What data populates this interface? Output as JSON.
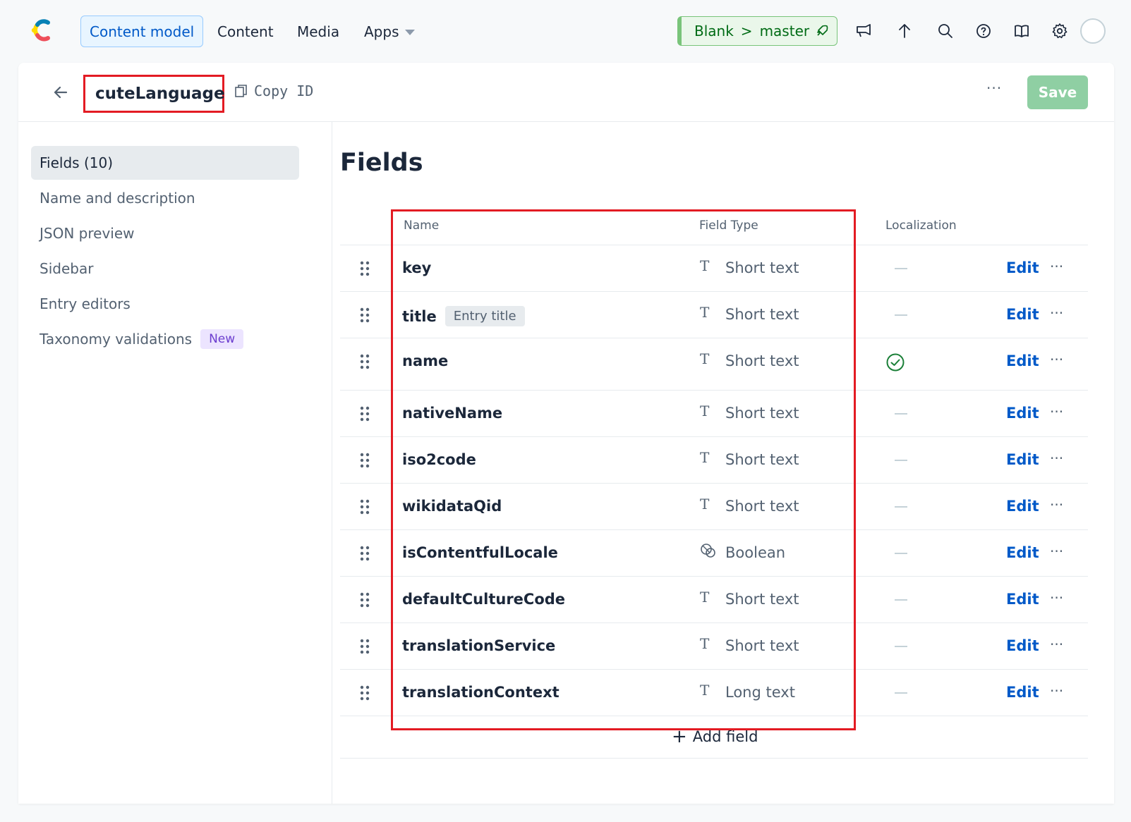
{
  "topnav": {
    "content_model": "Content model",
    "content": "Content",
    "media": "Media",
    "apps": "Apps",
    "env_space": "Blank",
    "env_sep": ">",
    "env_branch": "master"
  },
  "header": {
    "content_type_name": "cuteLanguage",
    "copy_id": "Copy ID",
    "more": "···",
    "save": "Save"
  },
  "sidebar": {
    "items": [
      {
        "label": "Fields (10)"
      },
      {
        "label": "Name and description"
      },
      {
        "label": "JSON preview"
      },
      {
        "label": "Sidebar"
      },
      {
        "label": "Entry editors"
      },
      {
        "label": "Taxonomy validations",
        "badge": "New"
      }
    ]
  },
  "fields": {
    "title": "Fields",
    "columns": {
      "name": "Name",
      "type": "Field Type",
      "localization": "Localization"
    },
    "rows": [
      {
        "name": "key",
        "type": "Short text",
        "icon": "T",
        "localized": false
      },
      {
        "name": "title",
        "badge": "Entry title",
        "type": "Short text",
        "icon": "T",
        "localized": false
      },
      {
        "name": "name",
        "type": "Short text",
        "icon": "T",
        "localized": true
      },
      {
        "name": "nativeName",
        "type": "Short text",
        "icon": "T",
        "localized": false
      },
      {
        "name": "iso2code",
        "type": "Short text",
        "icon": "T",
        "localized": false
      },
      {
        "name": "wikidataQid",
        "type": "Short text",
        "icon": "T",
        "localized": false
      },
      {
        "name": "isContentfulLocale",
        "type": "Boolean",
        "icon": "toggle-icon",
        "localized": false
      },
      {
        "name": "defaultCultureCode",
        "type": "Short text",
        "icon": "T",
        "localized": false
      },
      {
        "name": "translationService",
        "type": "Short text",
        "icon": "T",
        "localized": false
      },
      {
        "name": "translationContext",
        "type": "Long text",
        "icon": "T",
        "localized": false
      }
    ],
    "edit_label": "Edit",
    "more_label": "···",
    "add_field": "Add field"
  },
  "colors": {
    "accent": "#0059c8",
    "highlight": "#e31b23",
    "env_green": "#006b15",
    "save_disabled": "#8fcfa3"
  }
}
